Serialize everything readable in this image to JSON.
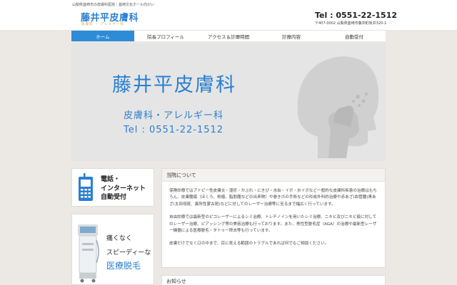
{
  "header": {
    "tagline": "山梨県韮崎市の皮膚科医院｜韮崎文化ホール向かい",
    "logo_title": "藤井平皮膚科",
    "logo_sub": "皮膚科 ・ アレルギー科",
    "tel": "Tel : 0551-22-1512",
    "address": "〒407-0002 山梨県韮崎市藤井町坂井320-1"
  },
  "nav": {
    "items": [
      {
        "label": "ホーム",
        "active": true
      },
      {
        "label": "院長プロフィール"
      },
      {
        "label": "アクセス＆診療時間"
      },
      {
        "label": "診療内容"
      },
      {
        "label": "自動受付"
      }
    ]
  },
  "hero": {
    "title": "藤井平皮膚科",
    "subtitle": "皮膚科・アレルギー科",
    "tel": "Tel : 0551-22-1512"
  },
  "sidebar": {
    "box1": {
      "line1": "電話・",
      "line2": "インターネット",
      "line3": "自動受付"
    },
    "box2": {
      "line1": "痛くなく",
      "line2": "スピーディーな",
      "line3": "医療脱毛"
    }
  },
  "main": {
    "heading": "当院について",
    "paragraphs": [
      "保険診療ではアトピー性皮膚炎・湿疹・かぶれ・にきび・水虫・イボ・水イボなど一般的な皮膚科疾患の治療はもちろん、皮膚腫瘍（ほくろ、粉瘤、脂肪腫などの出来物）や巻き爪の手術などの形成外科的治療や赤あざ(血管腫)青あざ(太田母斑、異所性蒙古斑)などに対してのレーザー治療等に至るまで幅広く行っています。",
      "自由診療では最新型のピコレーザーによるシミ治療、トレチノインを用いたシミ治療、ニキビ及びニキビ痕に対してのレーザー治療、ピアッシング等の美容治療も行っております。また、男性型脱毛症（AGA）の治療や最新型レーザー機器による医療脱毛・タトゥー除去等も行っています。",
      "皮膚だけでなく口の中まで、目に見える範囲のトラブルであれば何でもご相談ください。"
    ],
    "heading2": "お知らせ"
  },
  "colors": {
    "accent": "#2a7fd1",
    "nav_active": "#2e8bd8",
    "logo_sub": "#e0a030",
    "page_bg": "#ece8e4"
  }
}
